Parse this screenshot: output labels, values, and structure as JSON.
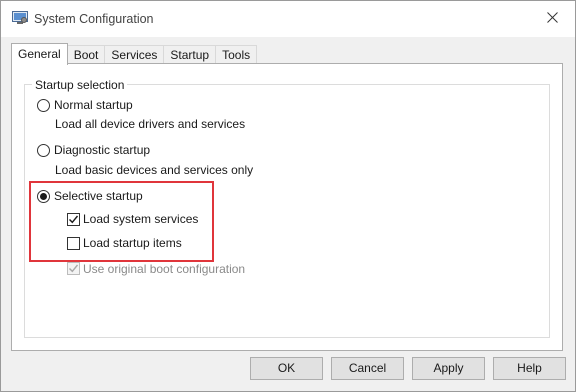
{
  "window": {
    "title": "System Configuration"
  },
  "tabs": [
    "General",
    "Boot",
    "Services",
    "Startup",
    "Tools"
  ],
  "startup_selection": {
    "group_label": "Startup selection",
    "normal": {
      "label": "Normal startup",
      "description": "Load all device drivers and services",
      "checked": false
    },
    "diagnostic": {
      "label": "Diagnostic startup",
      "description": "Load basic devices and services only",
      "checked": false
    },
    "selective": {
      "label": "Selective startup",
      "checked": true
    },
    "load_system_services": {
      "label": "Load system services",
      "checked": true
    },
    "load_startup_items": {
      "label": "Load startup items",
      "checked": false
    },
    "use_original_boot": {
      "label": "Use original boot configuration",
      "checked": true,
      "disabled": true
    }
  },
  "highlight_color": "#e0353b",
  "buttons": {
    "ok": "OK",
    "cancel": "Cancel",
    "apply": "Apply",
    "help": "Help"
  },
  "icons": {
    "app": "system-config-icon",
    "close": "close-icon"
  }
}
